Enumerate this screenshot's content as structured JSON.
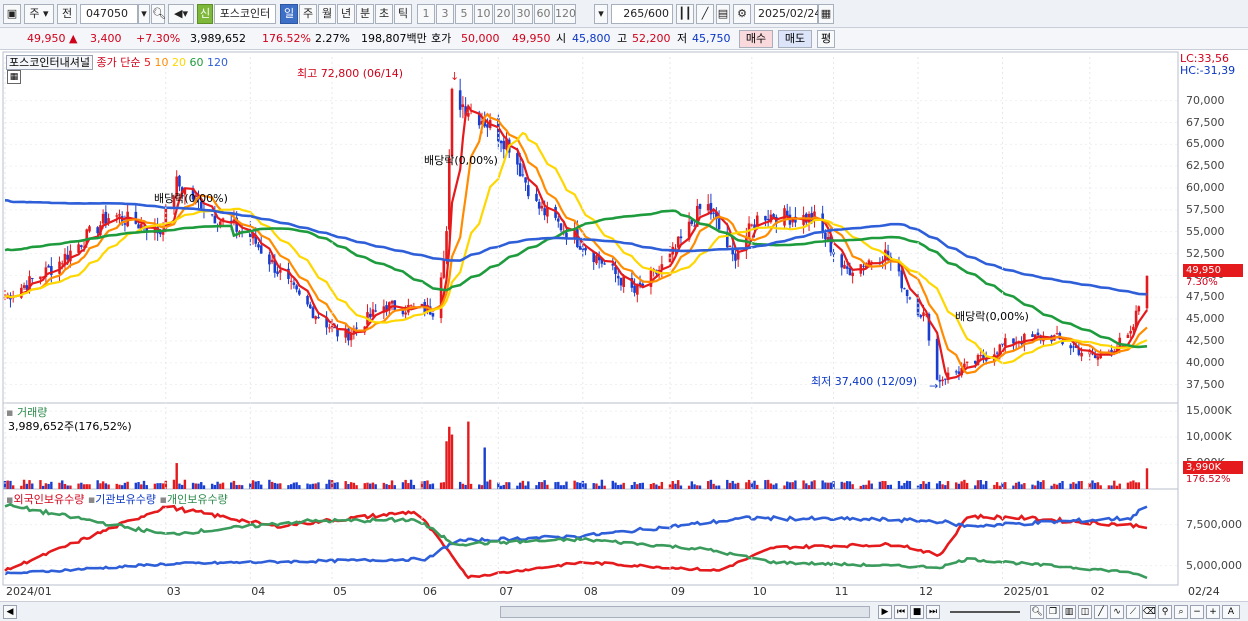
{
  "toolbar": {
    "market": "주",
    "prev_label": "전",
    "stock_code": "047050",
    "credit_badge": "신",
    "stock_name": "포스코인터",
    "periods": [
      "일",
      "주",
      "월",
      "년",
      "분",
      "초",
      "틱"
    ],
    "active_period": "일",
    "intervals": [
      "1",
      "3",
      "5",
      "10",
      "20",
      "30",
      "60",
      "120"
    ],
    "count": "265",
    "count_max": "/600",
    "date": "2025/02/24"
  },
  "quote": {
    "price": "49,950",
    "change": "3,400",
    "change_pct": "+7.30%",
    "volume": "3,989,652",
    "volume_pct": "176.52%",
    "turnover": "2.27%",
    "amount": "198,807백만",
    "ask_label": "호가",
    "ask": "50,000",
    "bid": "49,950",
    "open_label": "시",
    "open": "45,800",
    "high_label": "고",
    "high": "52,200",
    "low_label": "저",
    "low": "45,750",
    "buy_label": "매수",
    "sell_label": "매도",
    "eval_label": "평"
  },
  "price_panel": {
    "legend_name": "포스코인터내셔널",
    "legend_ma": "종가 단순",
    "ma_periods": [
      "5",
      "10",
      "20",
      "60",
      "120"
    ],
    "ma_colors": [
      "#e41a1c",
      "#ff8c00",
      "#ffd700",
      "#1e9b3c",
      "#2f5fd8"
    ],
    "lc": "LC:33,56",
    "hc": "HC:-31,39",
    "high_annotation": "최고 72,800 (06/14)",
    "low_annotation": "최저 37,400 (12/09)",
    "div_annotation_1": "배당락(0,00%)",
    "div_annotation_2": "배당락(0,00%)",
    "div_annotation_3": "배당락(0,00%)",
    "last_price_tag": "49,950",
    "last_pct_tag": "7.30%"
  },
  "volume_panel": {
    "title": "거래량",
    "value": "3,989,652주(176,52%)",
    "tag_value": "3,990K",
    "tag_pct": "176.52%"
  },
  "holdings_panel": {
    "series_labels": [
      "외국인보유수량",
      "기관보유수량",
      "개인보유수량"
    ]
  },
  "chart_data": [
    {
      "type": "candlestick",
      "title": "포스코인터내셔널",
      "y_ticks": [
        "70,000",
        "67,500",
        "65,000",
        "62,500",
        "60,000",
        "57,500",
        "55,000",
        "52,500",
        "50,000",
        "47,500",
        "45,000",
        "42,500",
        "40,000",
        "37,500"
      ],
      "ylim": [
        35500,
        75000
      ],
      "x_ticks": [
        "2024/01",
        "03",
        "04",
        "05",
        "06",
        "07",
        "08",
        "09",
        "10",
        "11",
        "12",
        "2025/01",
        "02",
        "02/24"
      ],
      "close_path": [
        [
          "2024-01-02",
          47500
        ],
        [
          "2024-01-20",
          51000
        ],
        [
          "2024-02-10",
          57000
        ],
        [
          "2024-02-28",
          55000
        ],
        [
          "2024-03-05",
          60500
        ],
        [
          "2024-03-20",
          56500
        ],
        [
          "2024-04-01",
          54500
        ],
        [
          "2024-04-20",
          47000
        ],
        [
          "2024-05-05",
          42800
        ],
        [
          "2024-05-20",
          46500
        ],
        [
          "2024-06-01",
          46200
        ],
        [
          "2024-06-08",
          46000
        ],
        [
          "2024-06-12",
          55000
        ],
        [
          "2024-06-14",
          70500
        ],
        [
          "2024-06-25",
          68000
        ],
        [
          "2024-07-05",
          65000
        ],
        [
          "2024-07-15",
          58000
        ],
        [
          "2024-08-01",
          53500
        ],
        [
          "2024-08-10",
          51000
        ],
        [
          "2024-08-20",
          48000
        ],
        [
          "2024-09-01",
          51500
        ],
        [
          "2024-09-15",
          58500
        ],
        [
          "2024-09-25",
          52000
        ],
        [
          "2024-10-05",
          57000
        ],
        [
          "2024-10-25",
          56500
        ],
        [
          "2024-11-05",
          50500
        ],
        [
          "2024-11-20",
          52500
        ],
        [
          "2024-11-30",
          47000
        ],
        [
          "2024-12-05",
          45000
        ],
        [
          "2024-12-09",
          38000
        ],
        [
          "2024-12-20",
          39500
        ],
        [
          "2025-01-05",
          42500
        ],
        [
          "2025-01-20",
          43000
        ],
        [
          "2025-02-05",
          40500
        ],
        [
          "2025-02-18",
          43000
        ],
        [
          "2025-02-21",
          46550
        ],
        [
          "2025-02-24",
          49950
        ]
      ],
      "ma_values_last": {
        "ma5": 46000,
        "ma10": 44000,
        "ma20": 42500,
        "ma60": 42200,
        "ma120": 47500
      },
      "high": {
        "date": "2024-06-14",
        "value": 72800
      },
      "low": {
        "date": "2024-12-09",
        "value": 37400
      }
    },
    {
      "type": "bar",
      "title": "거래량",
      "y_ticks": [
        "15,000K",
        "10,000K",
        "5,000K"
      ],
      "ylim": [
        0,
        16000
      ],
      "unit": "K",
      "spikes": [
        {
          "date": "2024-03-05",
          "value": 5000
        },
        {
          "date": "2024-06-12",
          "value": 9200
        },
        {
          "date": "2024-06-13",
          "value": 12000
        },
        {
          "date": "2024-06-14",
          "value": 10500
        },
        {
          "date": "2024-06-20",
          "value": 13000
        },
        {
          "date": "2024-06-26",
          "value": 8000
        },
        {
          "date": "2025-02-24",
          "value": 3990
        }
      ]
    },
    {
      "type": "line",
      "title": "보유수량",
      "y_ticks": [
        "7,500,000",
        "5,000,000"
      ],
      "series": [
        {
          "name": "외국인보유수량",
          "color": "#e41a1c",
          "points": [
            [
              "2024-01-02",
              4700000
            ],
            [
              "2024-03-01",
              8600000
            ],
            [
              "2024-04-10",
              7400000
            ],
            [
              "2024-06-01",
              8300000
            ],
            [
              "2024-06-20",
              4300000
            ],
            [
              "2024-08-01",
              5200000
            ],
            [
              "2024-09-20",
              4700000
            ],
            [
              "2024-10-10",
              6100000
            ],
            [
              "2024-11-25",
              6300000
            ],
            [
              "2024-12-10",
              5600000
            ],
            [
              "2024-12-20",
              8000000
            ],
            [
              "2025-01-10",
              7900000
            ],
            [
              "2025-02-24",
              7400000
            ]
          ]
        },
        {
          "name": "기관보유수량",
          "color": "#2f5fd8",
          "points": [
            [
              "2024-01-02",
              4500000
            ],
            [
              "2024-03-01",
              5100000
            ],
            [
              "2024-06-05",
              5400000
            ],
            [
              "2024-06-15",
              6500000
            ],
            [
              "2024-08-01",
              6800000
            ],
            [
              "2024-10-01",
              7900000
            ],
            [
              "2024-11-20",
              7800000
            ],
            [
              "2024-12-10",
              7700000
            ],
            [
              "2024-12-20",
              7400000
            ],
            [
              "2025-02-18",
              7900000
            ],
            [
              "2025-02-24",
              8700000
            ]
          ]
        },
        {
          "name": "개인보유수량",
          "color": "#3a9b5c",
          "points": [
            [
              "2024-01-02",
              8700000
            ],
            [
              "2024-03-01",
              6900000
            ],
            [
              "2024-04-20",
              7700000
            ],
            [
              "2024-06-01",
              7800000
            ],
            [
              "2024-06-15",
              6300000
            ],
            [
              "2024-08-01",
              6600000
            ],
            [
              "2024-09-15",
              6000000
            ],
            [
              "2024-10-10",
              5200000
            ],
            [
              "2024-12-10",
              4900000
            ],
            [
              "2024-12-20",
              5400000
            ],
            [
              "2025-02-18",
              4600000
            ],
            [
              "2025-02-24",
              4200000
            ]
          ]
        }
      ]
    }
  ],
  "footer": {
    "last_date_label": "02/24"
  }
}
